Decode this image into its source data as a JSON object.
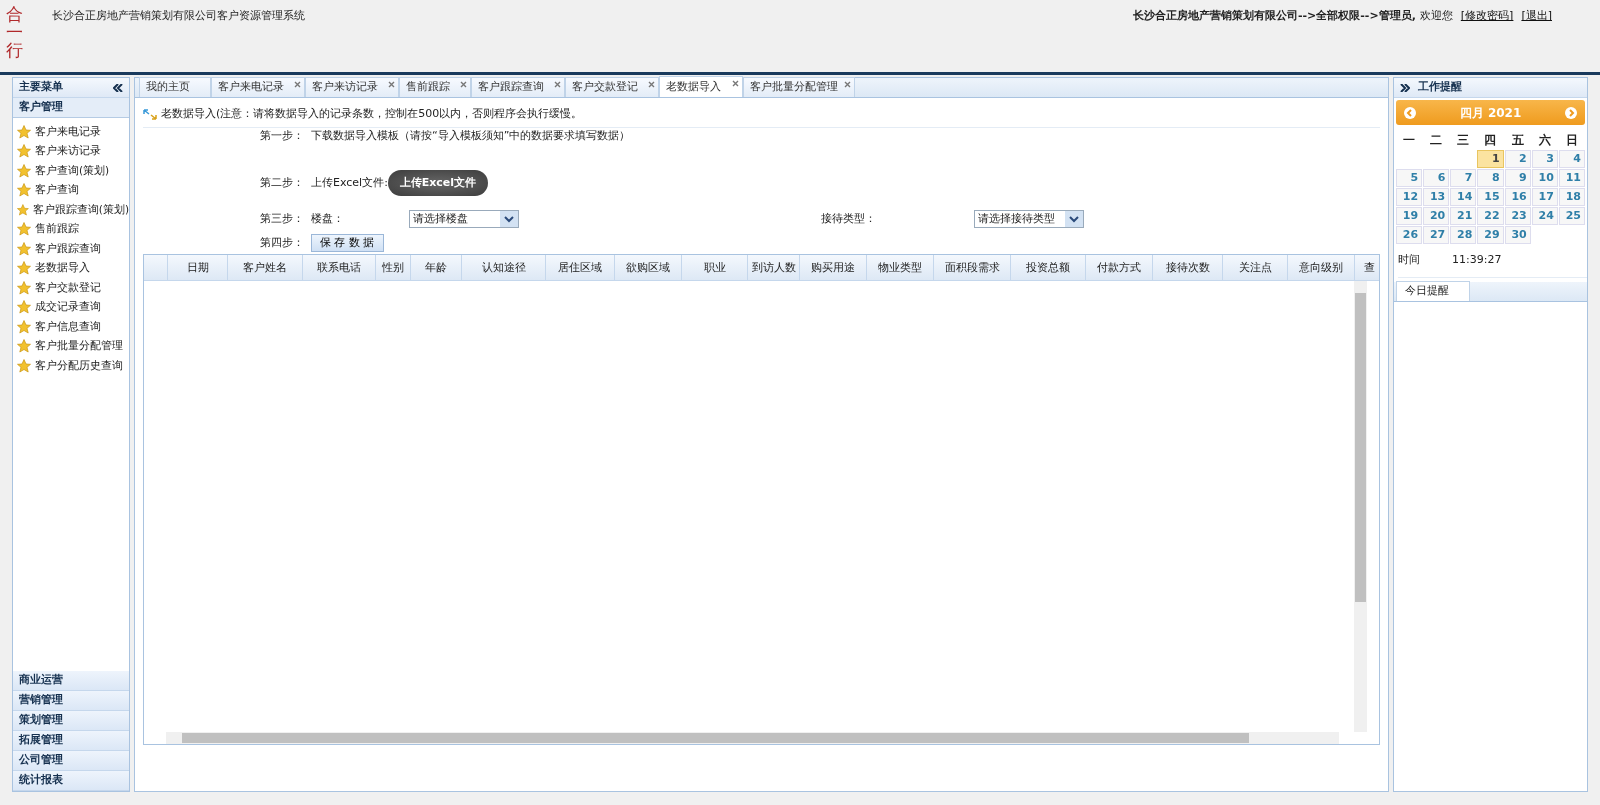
{
  "header": {
    "logo": "合一行",
    "title": "长沙合正房地产营销策划有限公司客户资源管理系统",
    "user_path": "长沙合正房地产营销策划有限公司-->全部权限-->管理员,",
    "welcome": "欢迎您",
    "links": [
      "[修改密码]",
      "[退出]"
    ]
  },
  "sidebar": {
    "title": "主要菜单",
    "sections": [
      {
        "label": "客户管理",
        "expanded": true,
        "items": [
          "客户来电记录",
          "客户来访记录",
          "客户查询(策划)",
          "客户查询",
          "客户跟踪查询(策划)",
          "售前跟踪",
          "客户跟踪查询",
          "老数据导入",
          "客户交款登记",
          "成交记录查询",
          "客户信息查询",
          "客户批量分配管理",
          "客户分配历史查询"
        ]
      },
      {
        "label": "商业运营",
        "expanded": false
      },
      {
        "label": "营销管理",
        "expanded": false
      },
      {
        "label": "策划管理",
        "expanded": false
      },
      {
        "label": "拓展管理",
        "expanded": false
      },
      {
        "label": "公司管理",
        "expanded": false
      },
      {
        "label": "统计报表",
        "expanded": false
      }
    ]
  },
  "tabs": [
    {
      "label": "我的主页",
      "closable": false,
      "selected": false
    },
    {
      "label": "客户来电记录",
      "closable": true,
      "selected": false
    },
    {
      "label": "客户来访记录",
      "closable": true,
      "selected": false
    },
    {
      "label": "售前跟踪",
      "closable": true,
      "selected": false
    },
    {
      "label": "客户跟踪查询",
      "closable": true,
      "selected": false
    },
    {
      "label": "客户交款登记",
      "closable": true,
      "selected": false
    },
    {
      "label": "老数据导入",
      "closable": true,
      "selected": true
    },
    {
      "label": "客户批量分配管理",
      "closable": true,
      "selected": false
    }
  ],
  "import": {
    "note": "老数据导入(注意：请将数据导入的记录条数，控制在500以内，否则程序会执行缓慢。",
    "step1": {
      "label": "第一步：",
      "text": "下载数据导入模板（请按“导入模板须知”中的数据要求填写数据）"
    },
    "step2": {
      "label": "第二步：",
      "text": "上传Excel文件:",
      "button": "上传Excel文件"
    },
    "step3": {
      "label": "第三步：",
      "field1": "楼盘：",
      "select1": "请选择楼盘",
      "field2": "接待类型：",
      "select2": "请选择接待类型"
    },
    "step4": {
      "label": "第四步：",
      "button": "保 存 数 据"
    }
  },
  "table": {
    "columns": [
      "日期",
      "客户姓名",
      "联系电话",
      "性别",
      "年龄",
      "认知途径",
      "居住区域",
      "欲购区域",
      "职业",
      "到访人数",
      "购买用途",
      "物业类型",
      "面积段需求",
      "投资总额",
      "付款方式",
      "接待次数",
      "关注点",
      "意向级别",
      "查"
    ]
  },
  "right_panel": {
    "title": "工作提醒",
    "calendar": {
      "month": "四月 2021",
      "weekdays": [
        "一",
        "二",
        "三",
        "四",
        "五",
        "六",
        "日"
      ],
      "days": [
        {
          "d": "1",
          "selected": true
        },
        {
          "d": "2",
          "selected": false
        },
        {
          "d": "3",
          "selected": false
        },
        {
          "d": "4",
          "selected": false
        },
        {
          "d": "5",
          "selected": false
        },
        {
          "d": "6",
          "selected": false
        },
        {
          "d": "7",
          "selected": false
        },
        {
          "d": "8",
          "selected": false
        },
        {
          "d": "9",
          "selected": false
        },
        {
          "d": "10",
          "selected": false
        },
        {
          "d": "11",
          "selected": false
        },
        {
          "d": "12",
          "selected": false
        },
        {
          "d": "13",
          "selected": false
        },
        {
          "d": "14",
          "selected": false
        },
        {
          "d": "15",
          "selected": false
        },
        {
          "d": "16",
          "selected": false
        },
        {
          "d": "17",
          "selected": false
        },
        {
          "d": "18",
          "selected": false
        },
        {
          "d": "19",
          "selected": false
        },
        {
          "d": "20",
          "selected": false
        },
        {
          "d": "21",
          "selected": false
        },
        {
          "d": "22",
          "selected": false
        },
        {
          "d": "23",
          "selected": false
        },
        {
          "d": "24",
          "selected": false
        },
        {
          "d": "25",
          "selected": false
        },
        {
          "d": "26",
          "selected": false
        },
        {
          "d": "27",
          "selected": false
        },
        {
          "d": "28",
          "selected": false
        },
        {
          "d": "29",
          "selected": false
        },
        {
          "d": "30",
          "selected": false
        }
      ]
    },
    "time_label": "时间",
    "time": "11:39:27",
    "tab": "今日提醒"
  }
}
